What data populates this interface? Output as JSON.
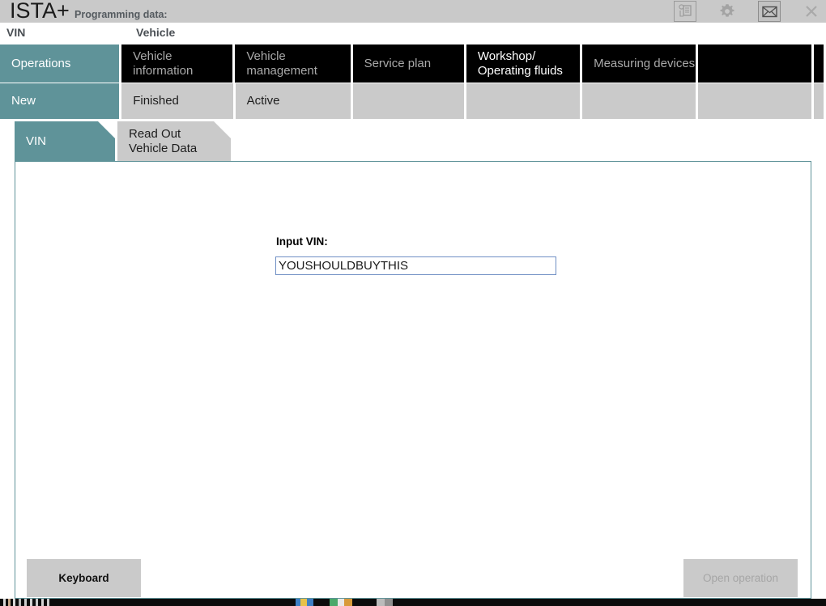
{
  "titlebar": {
    "app_name": "ISTA+",
    "programming_data_label": "Programming data:",
    "icons": [
      {
        "name": "documents-history-icon",
        "glyph": "⎘",
        "state": "disabled"
      },
      {
        "name": "gear-icon",
        "glyph": "⚙",
        "state": "disabled"
      },
      {
        "name": "envelope-icon",
        "glyph": "✉",
        "state": "active"
      },
      {
        "name": "close-icon",
        "glyph": "×",
        "state": "disabled"
      }
    ]
  },
  "breadcrumb": {
    "item1": "VIN",
    "item2": "Vehicle"
  },
  "nav": {
    "row1": [
      {
        "label": "Operations",
        "style": "teal",
        "selected": true
      },
      {
        "label": "Vehicle information",
        "style": "dark",
        "enabled": false
      },
      {
        "label": "Vehicle\nmanagement",
        "style": "dark",
        "enabled": false
      },
      {
        "label": "Service plan",
        "style": "dark",
        "enabled": false
      },
      {
        "label": "Workshop/\nOperating fluids",
        "style": "dark",
        "enabled": true
      },
      {
        "label": "Measuring devices",
        "style": "dark",
        "enabled": false
      },
      {
        "label": "",
        "style": "dark",
        "enabled": false
      },
      {
        "label": "",
        "style": "dark",
        "enabled": false
      }
    ],
    "row2": [
      {
        "label": "New",
        "style": "teal",
        "selected": true
      },
      {
        "label": "Finished",
        "style": "grey"
      },
      {
        "label": "Active",
        "style": "grey"
      },
      {
        "label": "",
        "style": "grey"
      },
      {
        "label": "",
        "style": "grey"
      },
      {
        "label": "",
        "style": "grey"
      },
      {
        "label": "",
        "style": "grey"
      },
      {
        "label": "",
        "style": "grey"
      }
    ],
    "row3": [
      {
        "label": "VIN",
        "style": "teal",
        "selected": true
      },
      {
        "label": "Read Out\nVehicle Data",
        "style": "grey"
      }
    ]
  },
  "main": {
    "vin_label": "Input VIN:",
    "vin_value": "YOUSHOULDBUYTHIS",
    "vin_placeholder": "",
    "keyboard_button": "Keyboard",
    "open_operation_button": "Open operation"
  },
  "colors": {
    "accent_teal": "#5f9399",
    "tab_dark": "#000000",
    "tab_grey": "#cacaca",
    "header_grey": "#c9c9c9",
    "input_border_blue": "#6f8fc4",
    "disabled_text": "#a6a6a6"
  }
}
